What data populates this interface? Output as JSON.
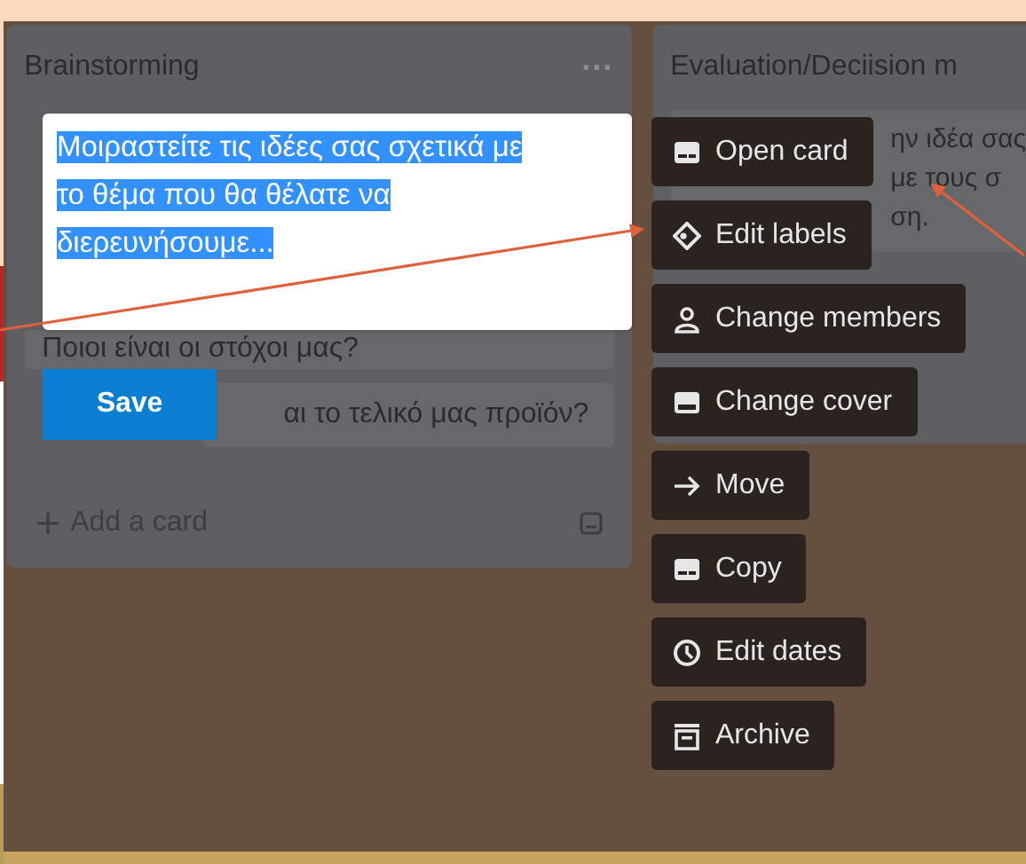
{
  "lists": [
    {
      "title": "Brainstorming",
      "menu": "···",
      "cards": [
        "Ποιοι είναι οι στόχοι μας?",
        "αι το τελικό μας προϊόν?"
      ],
      "add_card": "Add a card"
    },
    {
      "title": "Evaluation/Deciision m",
      "card_lines": [
        "ην ιδέα σας",
        "με τους σ",
        "ση."
      ]
    }
  ],
  "editor": {
    "value": "Μοιραστείτε τις ιδέες σας σχετικά με το θέμα που θα θέλατε να διερευνήσουμε...",
    "save": "Save"
  },
  "menu": [
    {
      "label": "Open card",
      "kind": "card"
    },
    {
      "label": "Edit labels",
      "kind": "tag"
    },
    {
      "label": "Change members",
      "kind": "person"
    },
    {
      "label": "Change cover",
      "kind": "cover"
    },
    {
      "label": "Move",
      "kind": "arrow"
    },
    {
      "label": "Copy",
      "kind": "card"
    },
    {
      "label": "Edit dates",
      "kind": "clock"
    },
    {
      "label": "Archive",
      "kind": "archive"
    }
  ]
}
